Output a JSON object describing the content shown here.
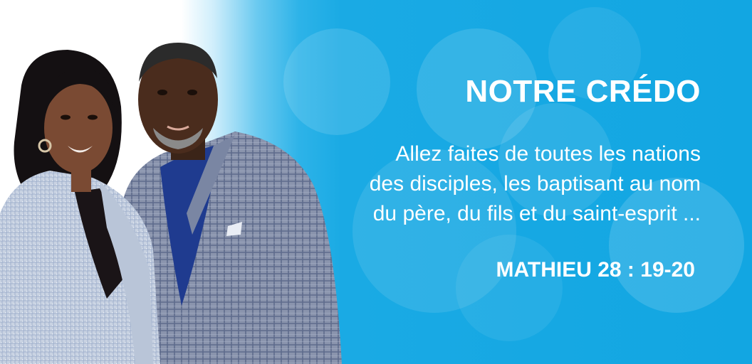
{
  "banner": {
    "title": "NOTRE CRÉDO",
    "verse_lines": [
      "Allez faites de toutes les nations",
      "des disciples, les baptisant au nom",
      "du père, du fils et du saint-esprit ..."
    ],
    "reference": "MATHIEU 28 : 19-20",
    "colors": {
      "background_blue": "#12a6e2",
      "text": "#ffffff",
      "jacket_woman": "#c9d3e2",
      "jacket_man": "#8c97b1",
      "shirt_man": "#1f3b8f"
    },
    "photo": {
      "subject": "couple-portrait",
      "description_icons": [
        "woman-figure",
        "man-figure"
      ]
    }
  }
}
